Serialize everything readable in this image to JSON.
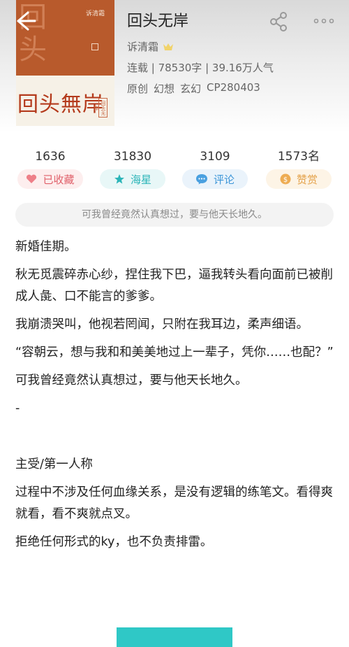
{
  "book": {
    "title": "回头无岸",
    "author": "诉清霜",
    "meta": "连载 | 78530字 | 39.16万人气",
    "tags": [
      "原创",
      "幻想",
      "玄幻",
      "CP280403"
    ]
  },
  "cover": {
    "author_text": "诉清霜",
    "title_text": "回头無岸",
    "big_chars": "回\n头\n无",
    "side_text": "回头无岸"
  },
  "stats": [
    {
      "value": "1636",
      "label": "已收藏",
      "icon": "heart-icon"
    },
    {
      "value": "31830",
      "label": "海星",
      "icon": "star-icon"
    },
    {
      "value": "3109",
      "label": "评论",
      "icon": "comment-icon"
    },
    {
      "value": "1573名",
      "label": "赞赏",
      "icon": "coin-icon"
    }
  ],
  "summary": "可我曾经竟然认真想过，要与他天长地久。",
  "intro": [
    "新婚佳期。",
    "秋无觅震碎赤心纱，捏住我下巴，逼我转头看向面前已被削成人彘、口不能言的爹爹。",
    "我崩溃哭叫，他视若罔闻，只附在我耳边，柔声细语。",
    "“容朝云，想与我和和美美地过上一辈子，凭你……也配？”",
    "可我曾经竟然认真想过，要与他天长地久。",
    "-",
    "",
    "主受/第一人称",
    "过程中不涉及任何血缘关系，是没有逻辑的练笔文。看得爽就看，看不爽就点叉。",
    "拒绝任何形式的ky，也不负责排雷。"
  ],
  "colors": {
    "accent": "#2fc8c6",
    "heart": "#e0606a",
    "cover": "#b85a2c"
  }
}
